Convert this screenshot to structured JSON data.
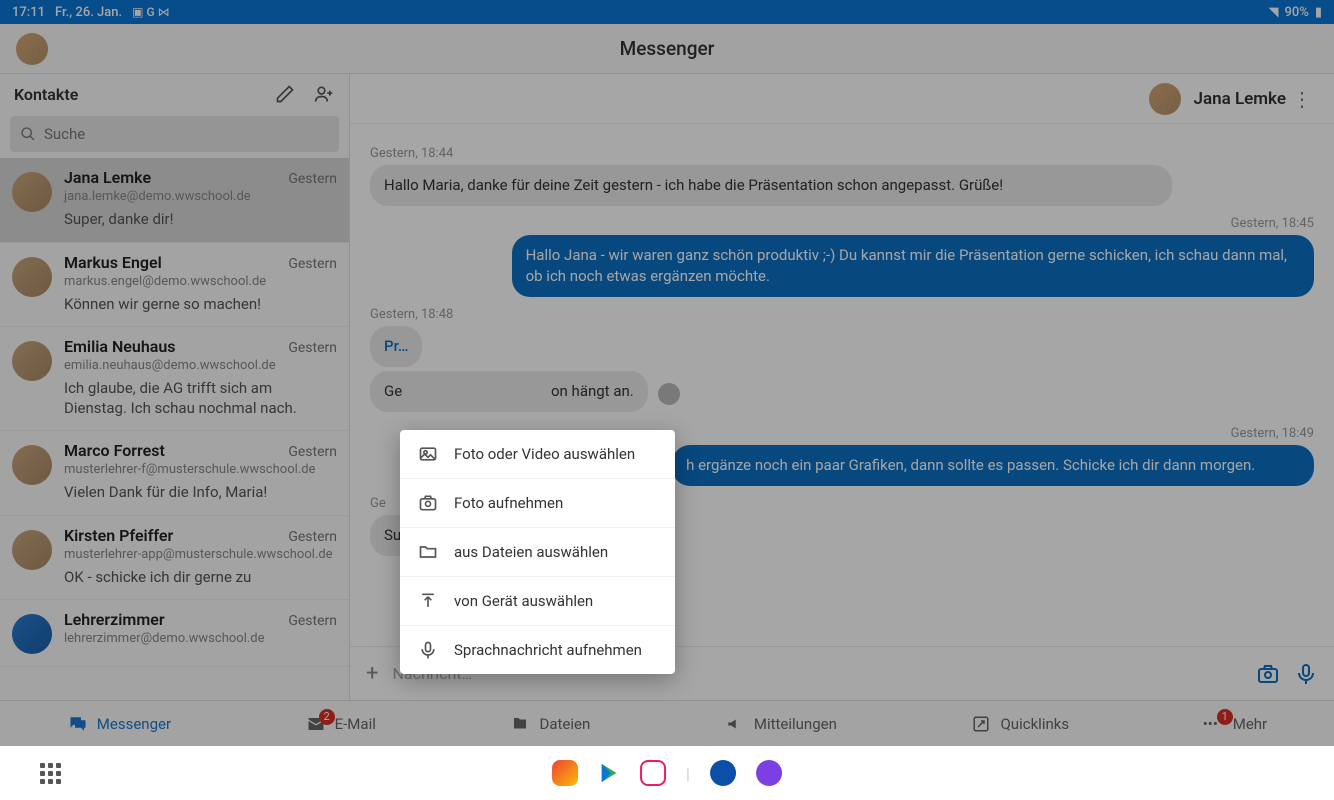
{
  "status": {
    "time": "17:11",
    "date": "Fr., 26. Jan.",
    "battery": "90%"
  },
  "header": {
    "title": "Messenger"
  },
  "sidebar": {
    "title": "Kontakte",
    "search_placeholder": "Suche"
  },
  "contacts": [
    {
      "name": "Jana Lemke",
      "email": "jana.lemke@demo.wwschool.de",
      "time": "Gestern",
      "preview": "Super, danke dir!"
    },
    {
      "name": "Markus Engel",
      "email": "markus.engel@demo.wwschool.de",
      "time": "Gestern",
      "preview": "Können wir gerne so machen!"
    },
    {
      "name": "Emilia Neuhaus",
      "email": "emilia.neuhaus@demo.wwschool.de",
      "time": "Gestern",
      "preview": "Ich glaube, die AG trifft sich am Dienstag. Ich schau nochmal nach."
    },
    {
      "name": "Marco Forrest",
      "email": "musterlehrer-f@musterschule.wwschool.de",
      "time": "Gestern",
      "preview": "Vielen Dank für die Info, Maria!"
    },
    {
      "name": "Kirsten Pfeiffer",
      "email": "musterlehrer-app@musterschule.wwschool.de",
      "time": "Gestern",
      "preview": "OK - schicke ich dir gerne zu"
    },
    {
      "name": "Lehrerzimmer",
      "email": "lehrerzimmer@demo.wwschool.de",
      "time": "Gestern",
      "preview": ""
    }
  ],
  "chat": {
    "partner": "Jana Lemke",
    "messages": {
      "t1": "Gestern, 18:44",
      "m1": "Hallo Maria, danke für deine Zeit gestern - ich habe die Präsentation schon angepasst. Grüße!",
      "t2": "Gestern, 18:45",
      "m2": "Hallo Jana - wir waren ganz schön produktiv ;-) Du kannst mir die Präsentation gerne schicken, ich schau dann mal, ob ich noch etwas ergänzen möchte.",
      "t3": "Gestern, 18:48",
      "m3_file": "Pr…",
      "m3b": "Ge",
      "m3b_rest": "on hängt an.",
      "t4": "Gestern, 18:49",
      "m4": "h ergänze noch ein paar Grafiken, dann sollte es passen. Schicke ich dir dann morgen.",
      "t5": "Ge",
      "m5_partial": "Su"
    },
    "input_placeholder": "Nachricht…"
  },
  "popup": {
    "items": [
      "Foto oder Video auswählen",
      "Foto aufnehmen",
      "aus Dateien auswählen",
      "von Gerät auswählen",
      "Sprachnachricht aufnehmen"
    ]
  },
  "nav": {
    "messenger": "Messenger",
    "email": "E-Mail",
    "email_badge": "2",
    "dateien": "Dateien",
    "mitteilungen": "Mitteilungen",
    "quicklinks": "Quicklinks",
    "mehr": "Mehr",
    "mehr_badge": "1"
  }
}
